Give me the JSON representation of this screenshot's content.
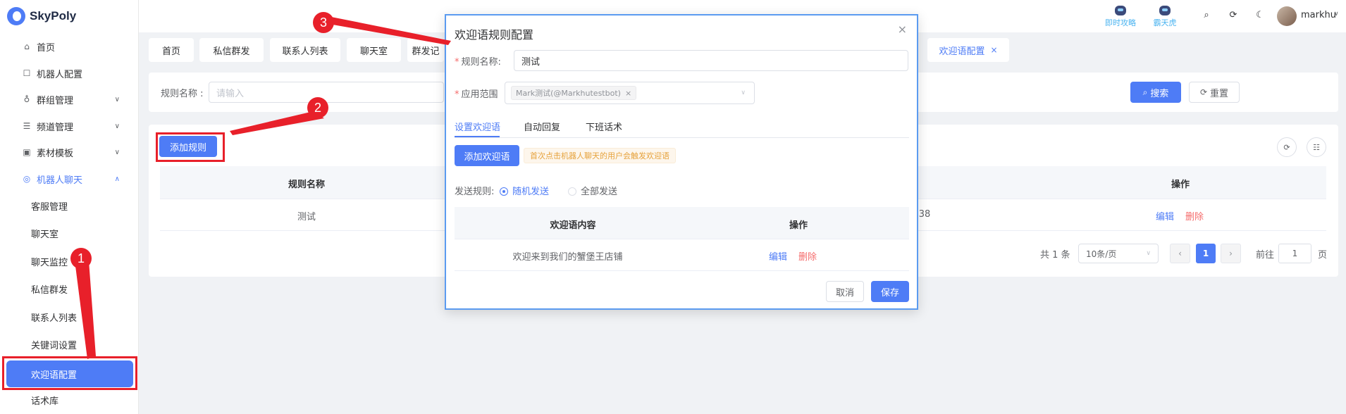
{
  "app": {
    "name": "SkyPoly"
  },
  "sidebar": {
    "items": [
      {
        "label": "首页",
        "icon": "home-icon"
      },
      {
        "label": "机器人配置",
        "icon": "robot-icon"
      },
      {
        "label": "群组管理",
        "icon": "group-icon"
      },
      {
        "label": "频道管理",
        "icon": "channel-icon"
      },
      {
        "label": "素材模板",
        "icon": "template-icon"
      },
      {
        "label": "机器人聊天",
        "icon": "chat-bot-icon"
      }
    ],
    "sub_items": [
      {
        "label": "客服管理"
      },
      {
        "label": "聊天室"
      },
      {
        "label": "聊天监控"
      },
      {
        "label": "私信群发"
      },
      {
        "label": "联系人列表"
      },
      {
        "label": "关键词设置"
      },
      {
        "label": "欢迎语配置"
      },
      {
        "label": "话术库"
      }
    ]
  },
  "header": {
    "badge1": "即时攻略",
    "badge2": "霸天虎",
    "username": "markhu"
  },
  "tabs": [
    {
      "label": "首页"
    },
    {
      "label": "私信群发"
    },
    {
      "label": "联系人列表"
    },
    {
      "label": "聊天室"
    },
    {
      "label": "群发记"
    },
    {
      "label": "欢迎语配置"
    }
  ],
  "search": {
    "rule_label": "规则名称 :",
    "rule_placeholder": "请输入",
    "search_btn": "搜索",
    "reset_btn": "重置"
  },
  "table": {
    "add_btn": "添加规则",
    "col_name": "规则名称",
    "col_action": "操作",
    "row": {
      "name": "测试",
      "time_fragment": "38",
      "edit": "编辑",
      "delete": "删除"
    }
  },
  "pagination": {
    "total": "共 1 条",
    "page_size": "10条/页",
    "current": "1",
    "goto_label": "前往",
    "goto_value": "1",
    "page_unit": "页"
  },
  "dialog": {
    "title": "欢迎语规则配置",
    "name_label": "规则名称:",
    "name_value": "测试",
    "scope_label": "应用范围",
    "scope_chip": "Mark测试(@Markhutestbot)",
    "tabs": [
      "设置欢迎语",
      "自动回复",
      "下班话术"
    ],
    "add_btn": "添加欢迎语",
    "hint": "首次点击机器人聊天的用户会触发欢迎语",
    "send_rule_label": "发送规则:",
    "radio_random": "随机发送",
    "radio_all": "全部发送",
    "col_content": "欢迎语内容",
    "col_action": "操作",
    "row": {
      "content": "欢迎来到我们的蟹堡王店铺",
      "edit": "编辑",
      "delete": "删除"
    },
    "cancel_btn": "取消",
    "save_btn": "保存"
  },
  "annotations": {
    "n1": "1",
    "n2": "2",
    "n3": "3"
  }
}
